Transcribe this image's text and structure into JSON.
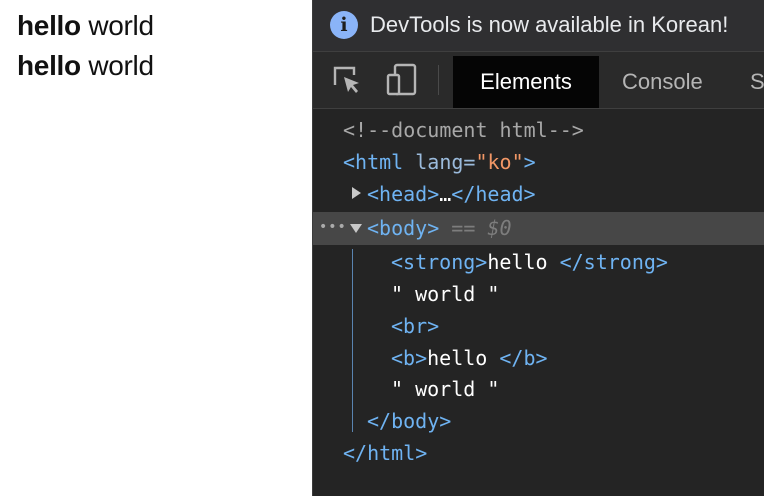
{
  "page": {
    "lines": [
      {
        "bold": "hello",
        "rest": "world"
      },
      {
        "bold": "hello",
        "rest": "world"
      }
    ]
  },
  "devtools": {
    "info_bar": {
      "text": "DevTools is now available in Korean!",
      "icon": "info-icon"
    },
    "toolbar": {
      "inspect_icon": "select-element-icon",
      "device_icon": "device-toggle-icon",
      "tabs": [
        "Elements",
        "Console",
        "S"
      ],
      "active_tab": "Elements"
    },
    "dom_tree": {
      "comment": "<!--document html-->",
      "html_open_tag": "<html",
      "html_attr": " lang=",
      "html_attr_value": "\"ko\"",
      "html_close_bracket": ">",
      "head_open": "<head>",
      "head_ellipsis": "…",
      "head_close": "</head>",
      "body_open": "<body>",
      "selected_marker": "== $0",
      "strong_open": "<strong>",
      "strong_text": "hello ",
      "strong_close": "</strong>",
      "text1": "\" world \"",
      "br": "<br>",
      "b_open": "<b>",
      "b_text": "hello ",
      "b_close": "</b>",
      "text2": "\" world \"",
      "body_close": "</body>",
      "html_close": "</html>"
    },
    "colors": {
      "panel_bg": "#242424",
      "tag": "#6fb3f2",
      "attribute_value": "#f29766",
      "selected_row": "#474747",
      "info_icon": "#8ab4f8"
    }
  }
}
